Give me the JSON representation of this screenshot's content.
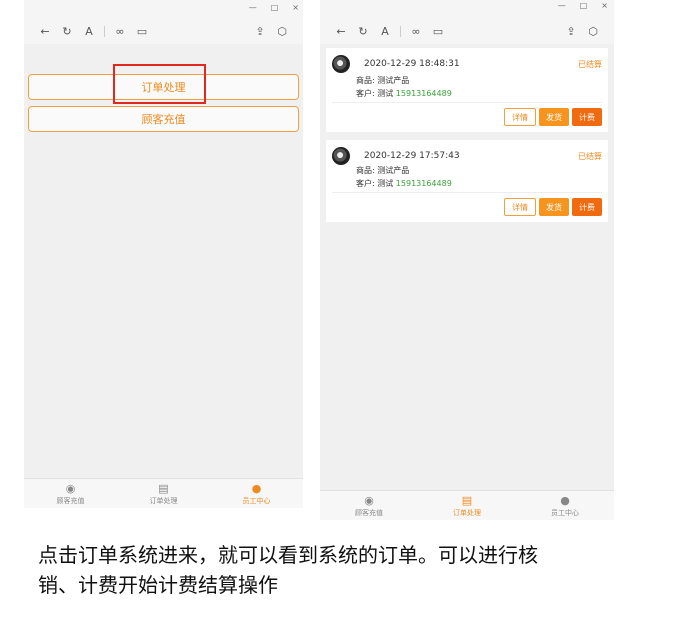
{
  "left_phone": {
    "toolbar_icons": [
      "back-icon",
      "refresh-icon",
      "font-icon",
      "link-icon",
      "window-icon",
      "share-icon",
      "cube-icon"
    ],
    "menu": {
      "order_processing": "订单处理",
      "customer_recharge": "顾客充值"
    },
    "tabs": [
      {
        "label": "顾客充值",
        "icon": "recharge-icon"
      },
      {
        "label": "订单处理",
        "icon": "clipboard-icon"
      },
      {
        "label": "员工中心",
        "icon": "person-icon"
      }
    ]
  },
  "right_phone": {
    "orders": [
      {
        "datetime": "2020-12-29 18:48:31",
        "status": "已结算",
        "product_label": "商品:",
        "product": "测试产品",
        "customer_label": "客户:",
        "customer_name": "测试",
        "phone": "15913164489",
        "btn_detail": "详情",
        "btn_ship": "发货",
        "btn_fee": "计费"
      },
      {
        "datetime": "2020-12-29 17:57:43",
        "status": "已结算",
        "product_label": "商品:",
        "product": "测试产品",
        "customer_label": "客户:",
        "customer_name": "测试",
        "phone": "15913164489",
        "btn_detail": "详情",
        "btn_ship": "发货",
        "btn_fee": "计费"
      }
    ],
    "tabs": [
      {
        "label": "顾客充值",
        "icon": "recharge-icon"
      },
      {
        "label": "订单处理",
        "icon": "clipboard-icon"
      },
      {
        "label": "员工中心",
        "icon": "person-icon"
      }
    ]
  },
  "caption": "点击订单系统进来，就可以看到系统的订单。可以进行核销、计费开始计费结算操作",
  "colors": {
    "accent": "#f08a20",
    "highlight": "#e0281e",
    "phone": "#3aa33a"
  }
}
